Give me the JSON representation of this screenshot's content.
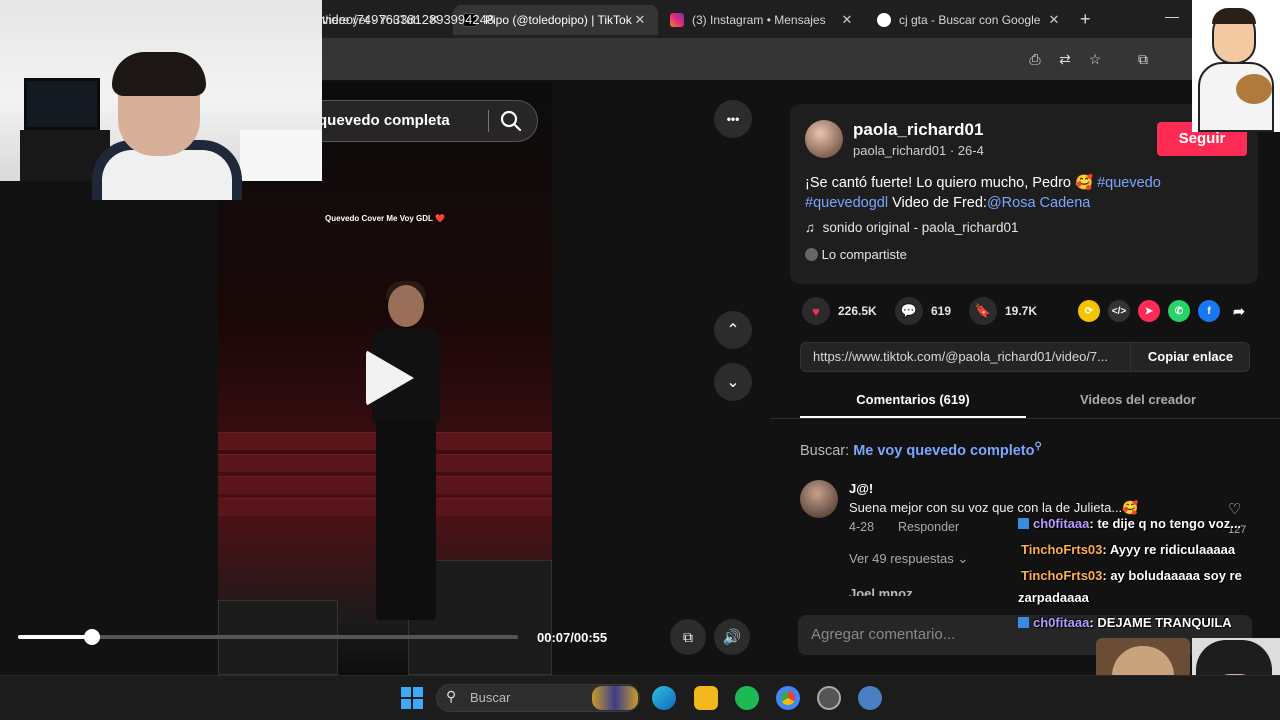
{
  "browser": {
    "tabs": [
      {
        "label": "there yet - YouTub",
        "active": false
      },
      {
        "label": "Pipo (@toledopipo) | TikTok",
        "active": true
      },
      {
        "label": "(3) Instagram • Mensajes",
        "active": false
      },
      {
        "label": "cj gta - Buscar con Google",
        "active": false
      }
    ],
    "new_tab": "+",
    "url": "video/7497633812893994248",
    "window_min": "—"
  },
  "video": {
    "search_text": "quevedo completa",
    "caption": "Quevedo Cover Me Voy GDL ❤️",
    "time": "00:07/00:55",
    "progress": 0.148,
    "more_icon": "•••",
    "up_icon": "⌃",
    "down_icon": "⌄"
  },
  "post": {
    "author_name": "paola_richard01",
    "author_sub": "paola_richard01 · 26-4",
    "follow_label": "Seguir",
    "desc_main": "¡Se cantó fuerte! Lo quiero mucho, Pedro 🥰 ",
    "tag1": "#quevedo",
    "tag2": "#quevedogdl",
    "desc_mid": " Video de Fred:",
    "mention": "@Rosa Cadena",
    "music": "sonido original - paola_richard01",
    "shared": "Lo compartiste",
    "likes": "226.5K",
    "comments": "619",
    "saves": "19.7K",
    "link": "https://www.tiktok.com/@paola_richard01/video/7...",
    "copy_label": "Copiar enlace"
  },
  "tabs": {
    "comments": "Comentarios (619)",
    "videos": "Videos del creador"
  },
  "search_comments": {
    "label": "Buscar: ",
    "query": "Me voy quevedo completo"
  },
  "comment": {
    "user": "J@!",
    "text": "Suena mejor con su voz que con la de Julieta...🥰",
    "date": "4-28",
    "reply": "Responder",
    "more": "Ver 49 respuestas ⌄",
    "likes": "127",
    "next_user": "Joel mnoz"
  },
  "comment_input": {
    "placeholder": "Agregar comentario..."
  },
  "chat": [
    {
      "user": "ch0fitaaa",
      "text": ": te dije q no tengo voz..."
    },
    {
      "user": "TinchoFrts03",
      "text": ": Ayyy re ridiculaaaaa"
    },
    {
      "user": "TinchoFrts03",
      "text": ": ay boludaaaaa soy re"
    },
    {
      "user": "",
      "text": "zarpadaaaa"
    },
    {
      "user": "ch0fitaaa",
      "text": ": DEJAME TRANQUILA"
    }
  ],
  "taskbar": {
    "search_label": "Buscar"
  },
  "colors": {
    "accent": "#fe2c55",
    "link": "#7aa7ff"
  }
}
